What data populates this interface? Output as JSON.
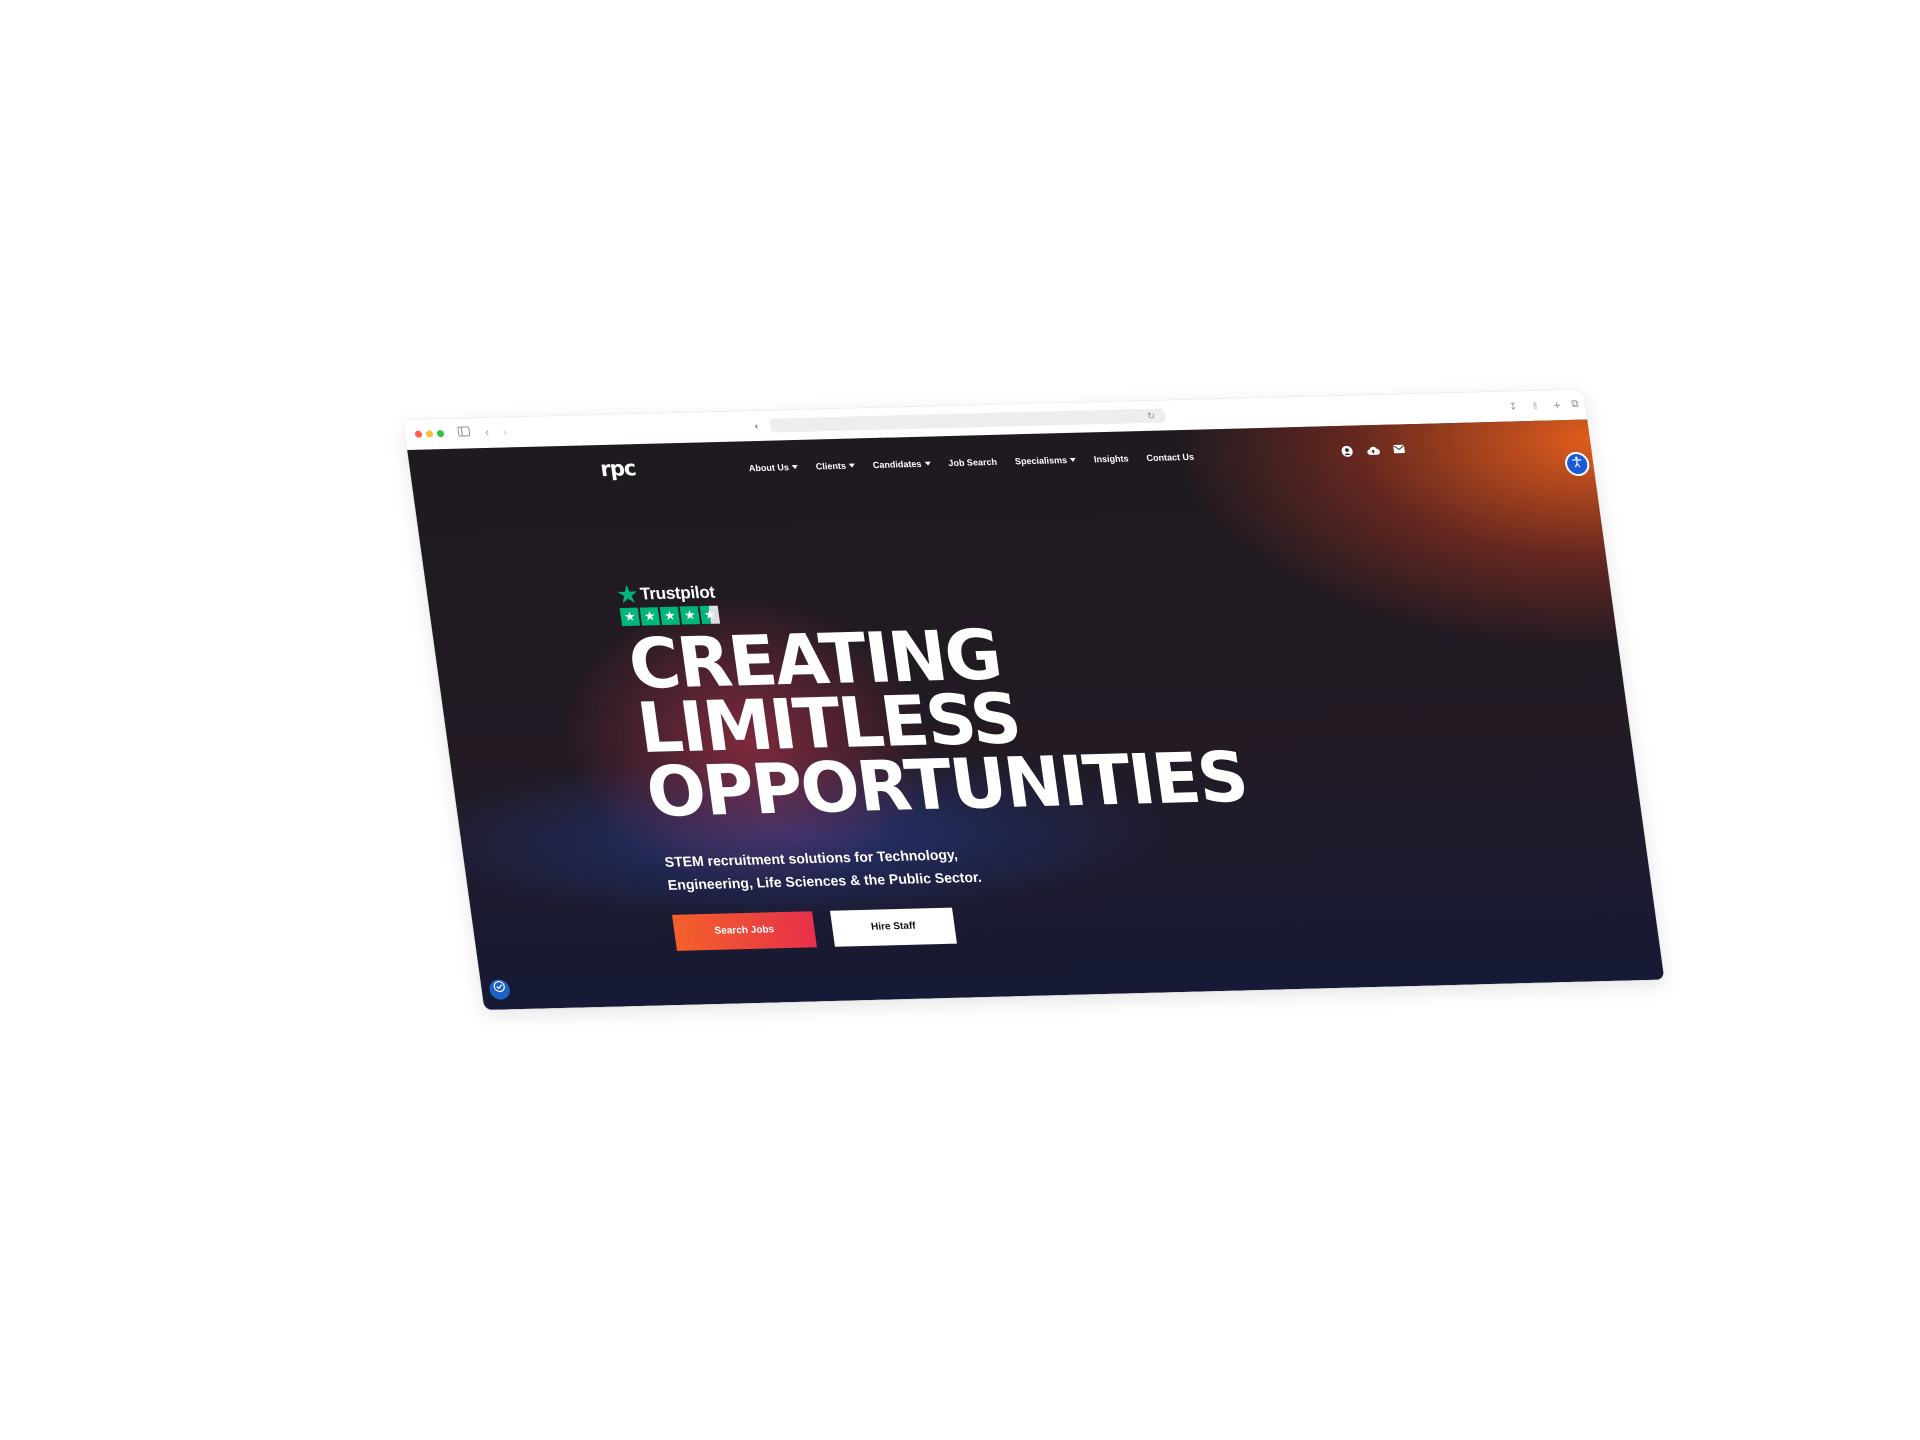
{
  "browser": {
    "toolbar_icons": {
      "sidebar": "sidebar-toggle-icon",
      "back": "chevron-left-icon",
      "forward": "chevron-right-icon",
      "privacy": "privacy-shield-icon",
      "reload": "reload-icon",
      "download": "download-icon",
      "share": "share-icon",
      "new_tab": "plus-icon",
      "tabs": "tab-overview-icon"
    }
  },
  "site": {
    "logo": "rpc",
    "nav": [
      {
        "label": "About Us",
        "dropdown": true
      },
      {
        "label": "Clients",
        "dropdown": true
      },
      {
        "label": "Candidates",
        "dropdown": true
      },
      {
        "label": "Job Search",
        "dropdown": false
      },
      {
        "label": "Specialisms",
        "dropdown": true
      },
      {
        "label": "Insights",
        "dropdown": false
      },
      {
        "label": "Contact Us",
        "dropdown": false
      }
    ],
    "header_icons": [
      "user-icon",
      "cloud-upload-icon",
      "mail-icon"
    ],
    "accessibility_icon": "accessibility-icon",
    "cookie_icon": "cookie-settings-icon"
  },
  "hero": {
    "trustpilot": {
      "brand": "Trustpilot",
      "rating_stars": 4.5,
      "star_color": "#00b67a"
    },
    "headline_lines": [
      "CREATING",
      "LIMITLESS",
      "OPPORTUNITIES"
    ],
    "subtitle": "STEM recruitment solutions for Technology, Engineering, Life Sciences & the Public Sector.",
    "primary_cta": "Search Jobs",
    "secondary_cta": "Hire Staff"
  },
  "colors": {
    "primary_gradient_start": "#f3612a",
    "primary_gradient_end": "#e8304a",
    "accent_orange": "#ea601c",
    "accessibility_blue": "#1a5ad7"
  }
}
